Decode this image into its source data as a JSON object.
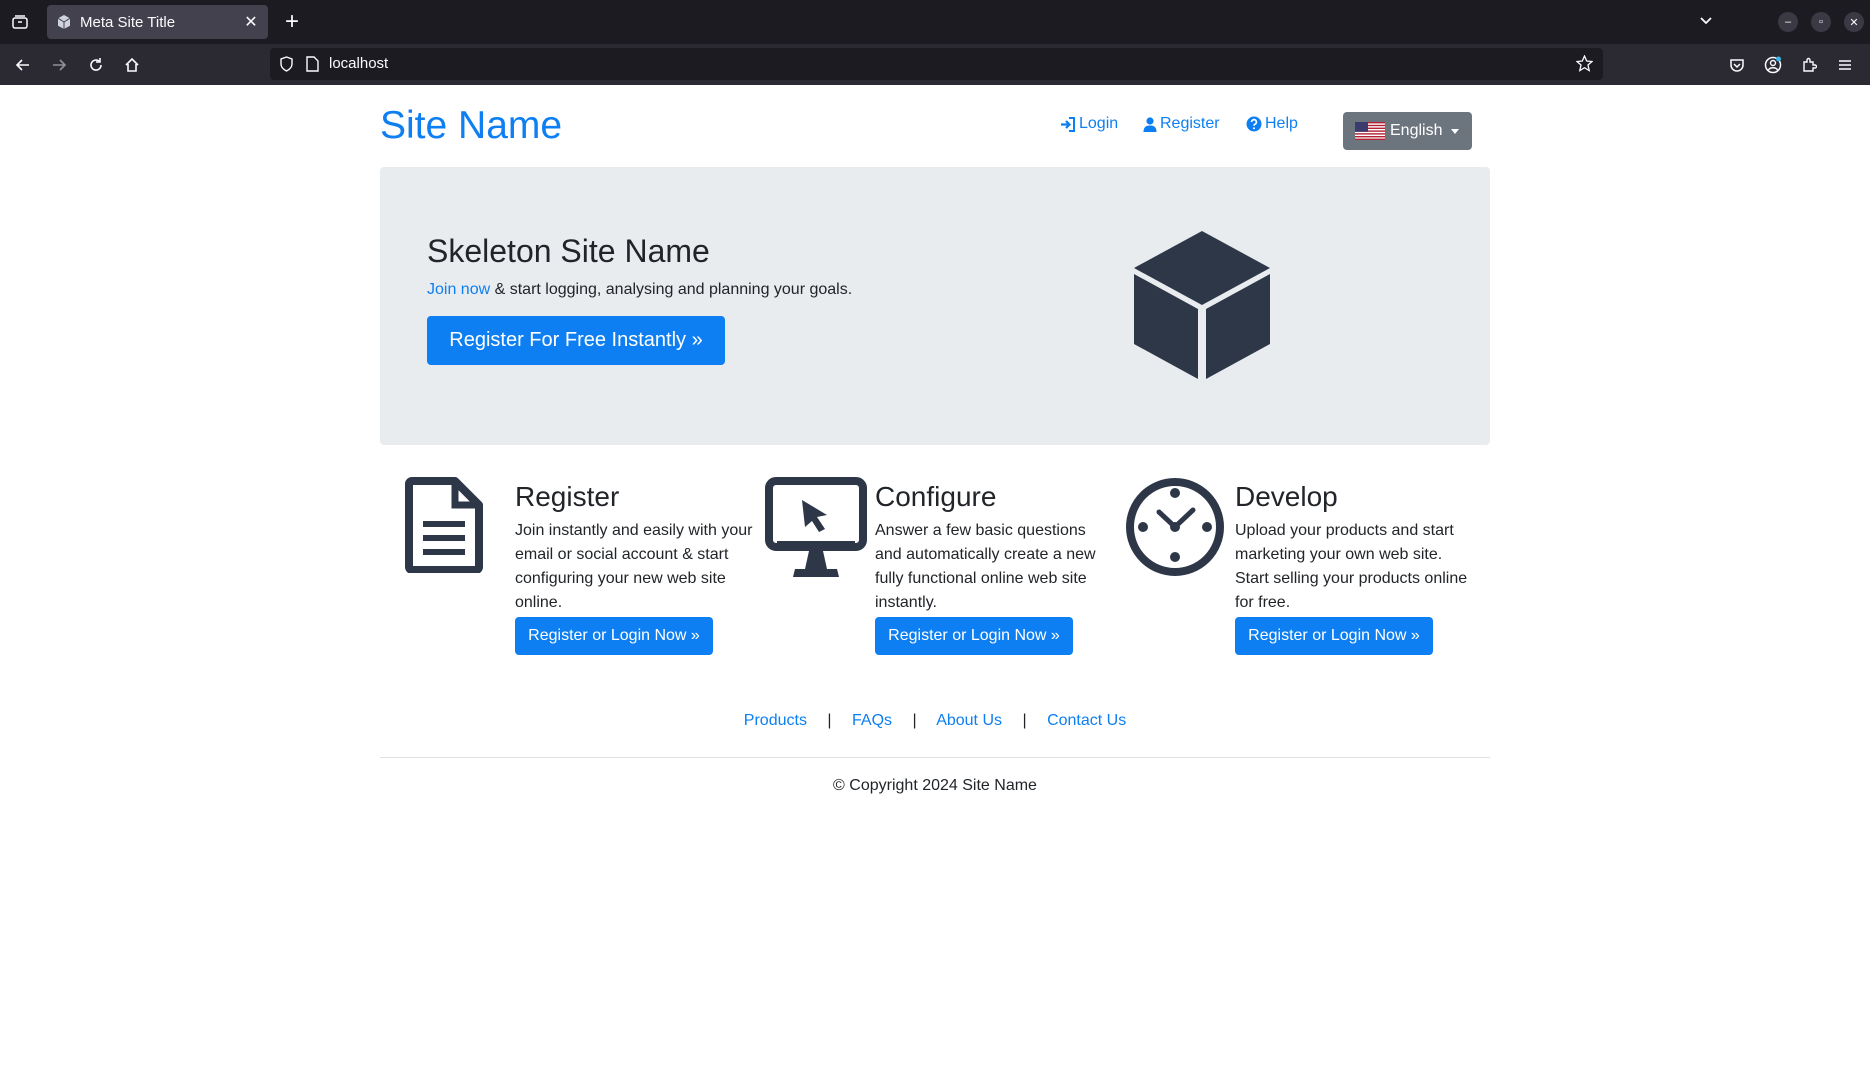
{
  "browser": {
    "tab_title": "Meta Site Title",
    "tab_close": "✕",
    "new_tab": "+",
    "url": "localhost",
    "window_buttons": [
      "–",
      "▫",
      "✕"
    ]
  },
  "header": {
    "brand": "Site Name",
    "nav": {
      "login": "Login",
      "register": "Register",
      "help": "Help"
    },
    "language": "English"
  },
  "hero": {
    "title": "Skeleton Site Name",
    "link_text": "Join now",
    "lead_text": " & start logging, analysing and planning your goals.",
    "cta": "Register For Free Instantly »",
    "icon": "cube-icon"
  },
  "features": [
    {
      "title": "Register",
      "text": "Join instantly and easily with your email or social account & start configuring your new web site online.",
      "button": "Register or Login Now »",
      "icon": "document-icon"
    },
    {
      "title": "Configure",
      "text": "Answer a few basic questions and automatically create a new fully functional online web site instantly.",
      "button": "Register or Login Now »",
      "icon": "monitor-cursor-icon"
    },
    {
      "title": "Develop",
      "text": "Upload your products and start marketing your own web site. Start selling your products online for free.",
      "button": "Register or Login Now »",
      "icon": "clock-icon"
    }
  ],
  "footer": {
    "links": [
      "Products",
      "FAQs",
      "About Us",
      "Contact Us"
    ],
    "separator": "|",
    "copyright": "© Copyright 2024 Site Name"
  },
  "colors": {
    "primary": "#0d7ff2",
    "jumbotron_bg": "#e9ecef",
    "icon_dark": "#2d3748",
    "lang_button": "#6c757d"
  }
}
